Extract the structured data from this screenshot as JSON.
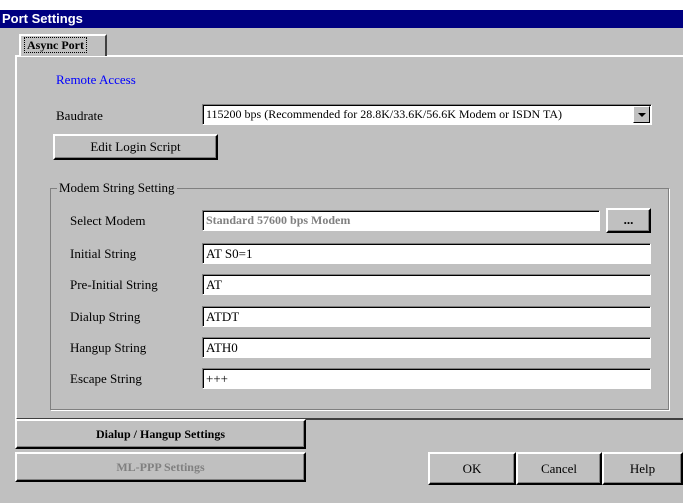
{
  "window": {
    "title": "Port Settings"
  },
  "tabs": [
    {
      "label": "Async Port"
    }
  ],
  "section_heading": "Remote Access",
  "baudrate": {
    "label": "Baudrate",
    "selected": "115200 bps (Recommended for 28.8K/33.6K/56.6K Modem or ISDN TA)"
  },
  "edit_login_script_label": "Edit Login Script",
  "modem_group": {
    "legend": "Modem String Setting",
    "select_modem": {
      "label": "Select Modem",
      "value": "Standard 57600 bps Modem",
      "browse_label": "..."
    },
    "fields": [
      {
        "label": "Initial String",
        "value": "AT S0=1"
      },
      {
        "label": "Pre-Initial String",
        "value": "AT"
      },
      {
        "label": "Dialup String",
        "value": "ATDT"
      },
      {
        "label": "Hangup String",
        "value": "ATH0"
      },
      {
        "label": "Escape String",
        "value": "+++"
      }
    ]
  },
  "buttons": {
    "dialup_hangup": "Dialup / Hangup Settings",
    "mlppp": "ML-PPP Settings",
    "ok": "OK",
    "cancel": "Cancel",
    "help": "Help"
  }
}
